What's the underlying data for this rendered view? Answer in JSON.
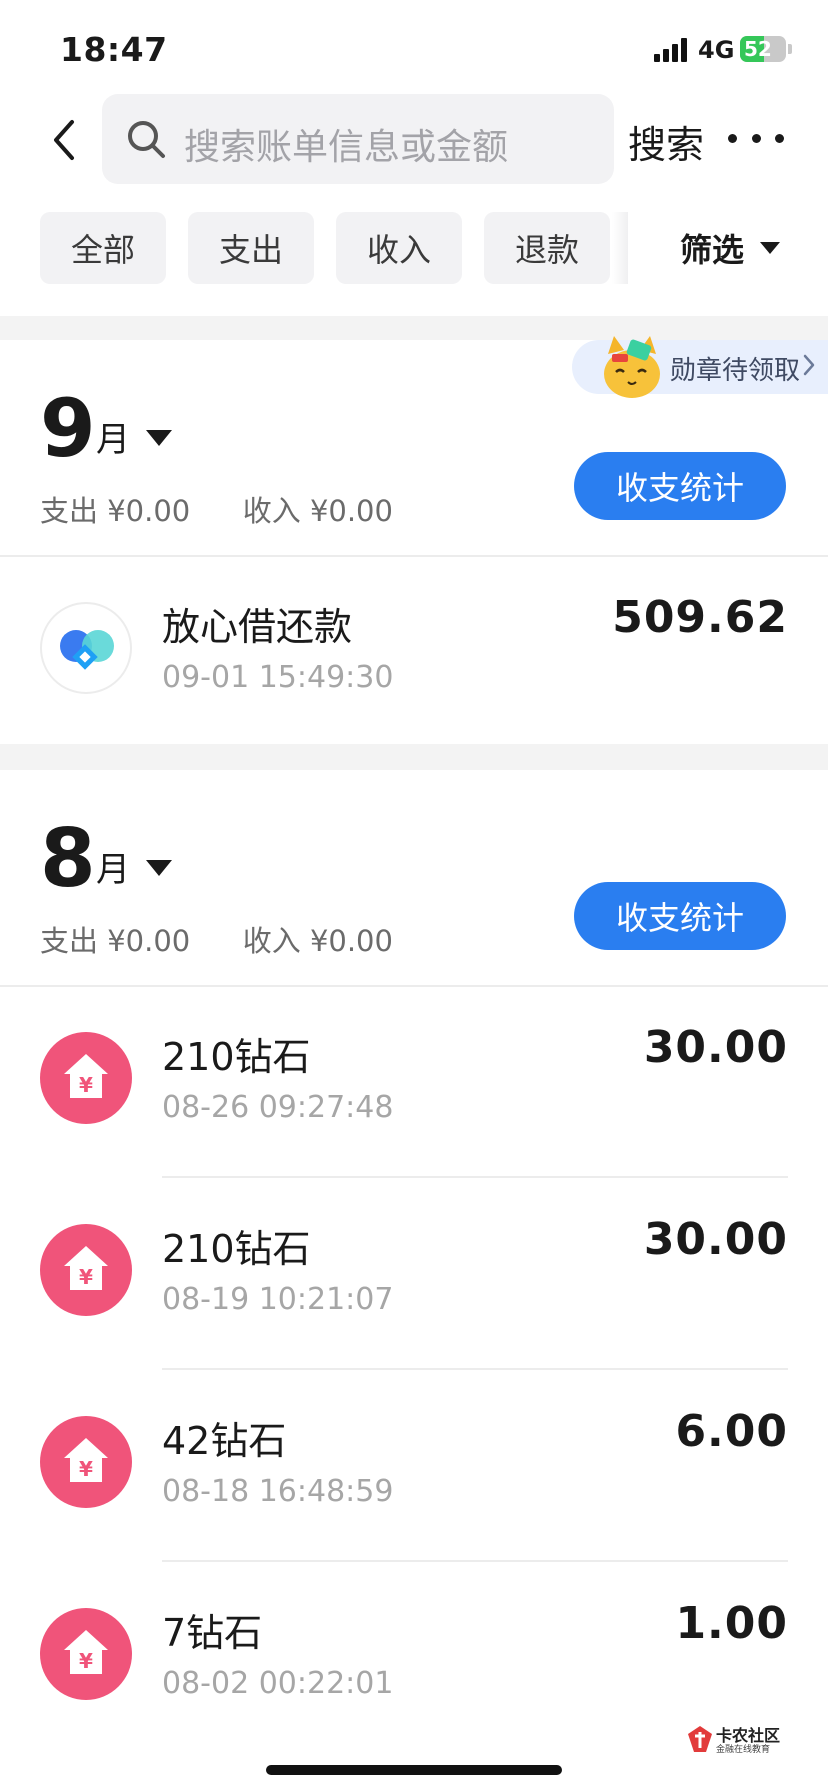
{
  "status_bar": {
    "time": "18:47",
    "network": "4G",
    "battery": 52,
    "battery_label": "52"
  },
  "header": {
    "search_placeholder": "搜索账单信息或金额",
    "search_button": "搜索"
  },
  "filters": {
    "chips": [
      "全部",
      "支出",
      "收入",
      "退款"
    ],
    "filter_label": "筛选"
  },
  "badge": {
    "label": "勋章待领取"
  },
  "months": [
    {
      "month_number": "9",
      "month_unit": "月",
      "expense_label": "支出",
      "expense_value": "¥0.00",
      "income_label": "收入",
      "income_value": "¥0.00",
      "stats_button": "收支统计",
      "transactions": [
        {
          "title": "放心借还款",
          "date": "09-01 15:49:30",
          "amount": "509.62",
          "icon": "fangxinjie-logo-icon"
        }
      ]
    },
    {
      "month_number": "8",
      "month_unit": "月",
      "expense_label": "支出",
      "expense_value": "¥0.00",
      "income_label": "收入",
      "income_value": "¥0.00",
      "stats_button": "收支统计",
      "transactions": [
        {
          "title": "210钻石",
          "date": "08-26 09:27:48",
          "amount": "30.00",
          "icon": "yuan-house-icon"
        },
        {
          "title": "210钻石",
          "date": "08-19 10:21:07",
          "amount": "30.00",
          "icon": "yuan-house-icon"
        },
        {
          "title": "42钻石",
          "date": "08-18 16:48:59",
          "amount": "6.00",
          "icon": "yuan-house-icon"
        },
        {
          "title": "7钻石",
          "date": "08-02 00:22:01",
          "amount": "1.00",
          "icon": "yuan-house-icon"
        }
      ]
    }
  ],
  "watermark": {
    "name": "卡农社区",
    "tagline": "金融在线教育"
  },
  "colors": {
    "accent": "#2a7ef0",
    "pink_icon": "#f0547a",
    "battery_green": "#35c759"
  }
}
